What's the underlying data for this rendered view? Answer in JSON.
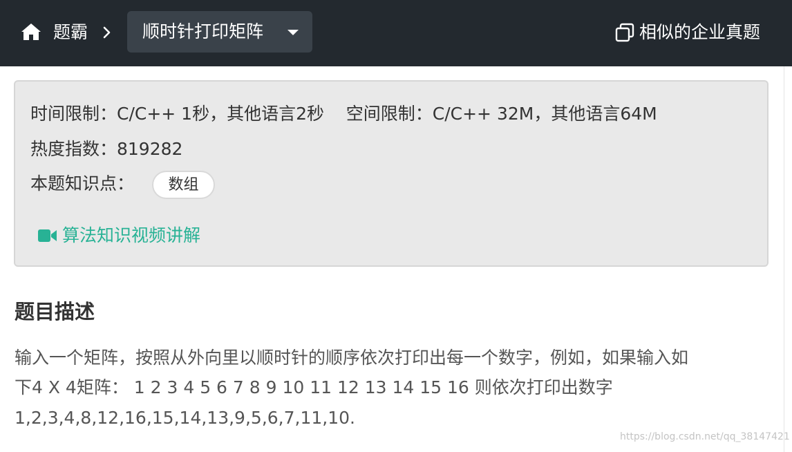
{
  "header": {
    "breadcrumb_root": "题霸",
    "current_title": "顺时针打印矩阵",
    "similar_label": "相似的企业真题",
    "icons": {
      "home": "home-icon",
      "separator": "chevron-right-icon",
      "dropdown": "caret-down-icon",
      "similar": "copy-icon"
    },
    "colors": {
      "bar": "#23292f",
      "current_bg": "#3a424a"
    }
  },
  "info": {
    "limits": "时间限制：C/C++ 1秒，其他语言2秒    空间限制：C/C++ 32M，其他语言64M",
    "heat": "热度指数：819282",
    "knowledge_label": "本题知识点：",
    "tags": [
      "数组"
    ],
    "video_link": "算法知识视频讲解",
    "icons": {
      "video": "video-camera-icon"
    },
    "colors": {
      "link": "#28b295"
    }
  },
  "description": {
    "title": "题目描述",
    "lines": [
      "输入一个矩阵，按照从外向里以顺时针的顺序依次打印出每一个数字，例如，如果输入如",
      "下4 X 4矩阵： 1 2 3 4 5 6 7 8 9 10 11 12 13 14 15 16 则依次打印出数字",
      "1,2,3,4,8,12,16,15,14,13,9,5,6,7,11,10."
    ]
  },
  "watermark": "https://blog.csdn.net/qq_38147421"
}
